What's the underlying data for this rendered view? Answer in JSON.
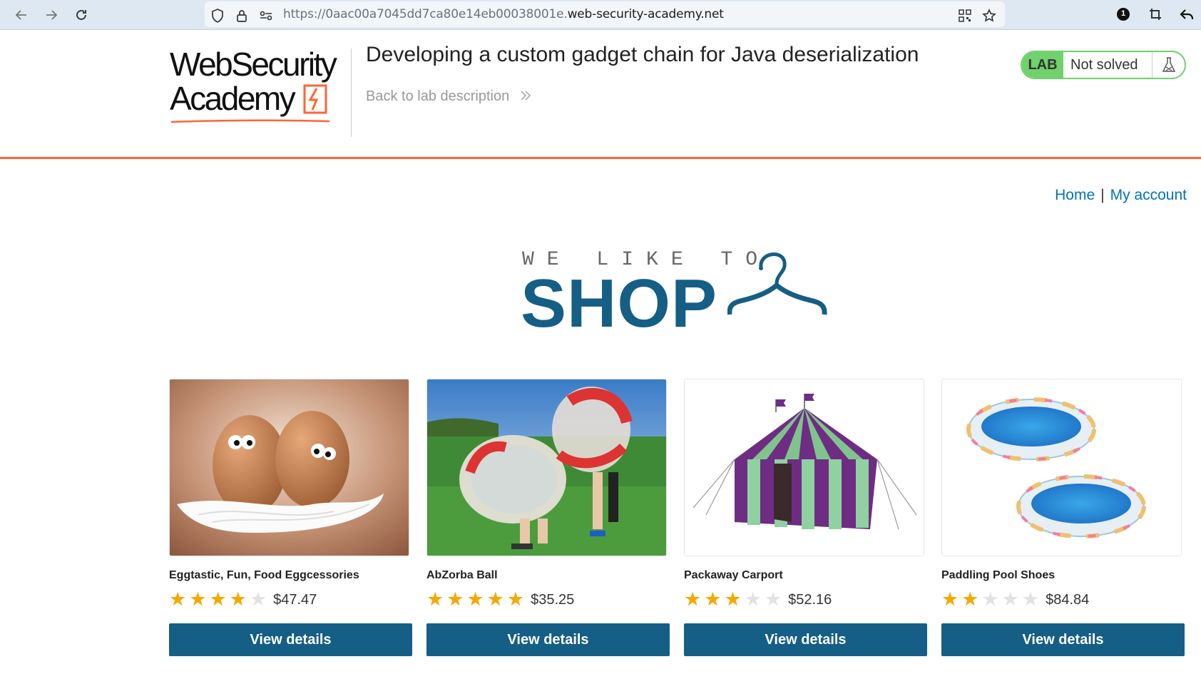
{
  "browser": {
    "url_prefix": "https://0aac00a7045dd7ca80e14eb00038001e.",
    "url_domain": "web-security-academy.net",
    "extension_badge": "1"
  },
  "lab": {
    "logo_line1": "WebSecurity",
    "logo_line2": "Academy",
    "title": "Developing a custom gadget chain for Java deserialization",
    "back_link": "Back to lab description",
    "status_tag": "LAB",
    "status_text": "Not solved",
    "accent_color": "#ff6633",
    "solved_color": "#70d16d"
  },
  "nav": {
    "home": "Home",
    "separator": "|",
    "account": "My account"
  },
  "banner": {
    "tagline": "WE LIKE TO",
    "heading": "SHOP",
    "brand_color": "#155e85"
  },
  "products": [
    {
      "name": "Eggtastic, Fun, Food Eggcessories",
      "stars": 4,
      "price": "$47.47",
      "button": "View details",
      "image": "eggs-with-feathers"
    },
    {
      "name": "AbZorba Ball",
      "stars": 5,
      "price": "$35.25",
      "button": "View details",
      "image": "inflatable-bumper-balls"
    },
    {
      "name": "Packaway Carport",
      "stars": 3,
      "price": "$52.16",
      "button": "View details",
      "image": "striped-tent"
    },
    {
      "name": "Paddling Pool Shoes",
      "stars": 2,
      "price": "$84.84",
      "button": "View details",
      "image": "paddling-pools"
    }
  ]
}
